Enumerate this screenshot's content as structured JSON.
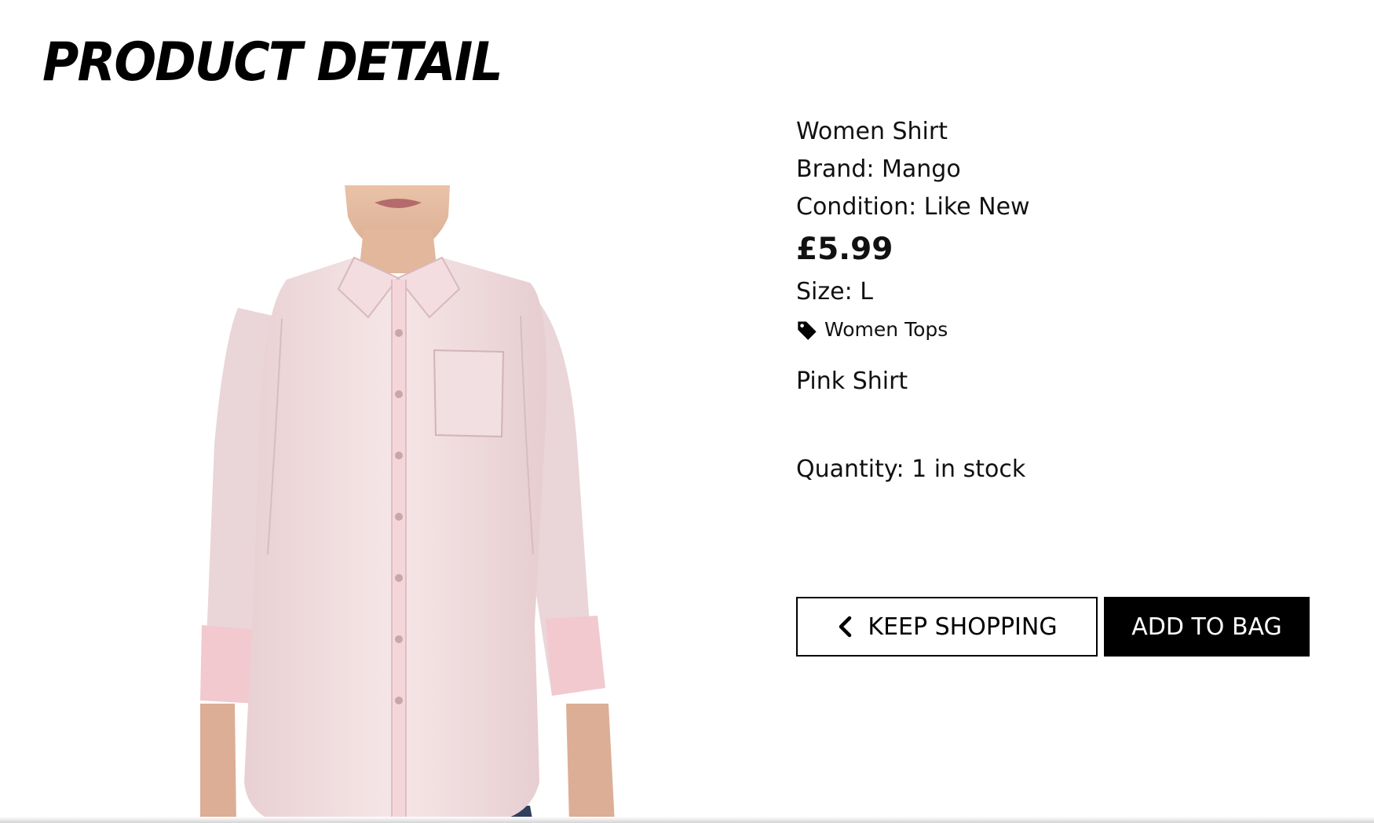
{
  "page": {
    "title": "PRODUCT DETAIL"
  },
  "product": {
    "name": "Women Shirt",
    "brand": "Brand: Mango",
    "condition": "Condition: Like New",
    "price": "£5.99",
    "size": "Size: L",
    "category": "Women Tops",
    "description": "Pink Shirt",
    "quantity": "Quantity: 1 in stock",
    "image_icon": "product-photo-pink-shirt"
  },
  "actions": {
    "keep_shopping_label": "KEEP SHOPPING",
    "add_to_bag_label": "ADD TO BAG"
  },
  "icons": {
    "category": "tag-icon",
    "back": "chevron-left-icon"
  },
  "colors": {
    "text": "#111111",
    "primary_button_bg": "#000000",
    "primary_button_text": "#ffffff",
    "shirt": "#f2dede"
  }
}
